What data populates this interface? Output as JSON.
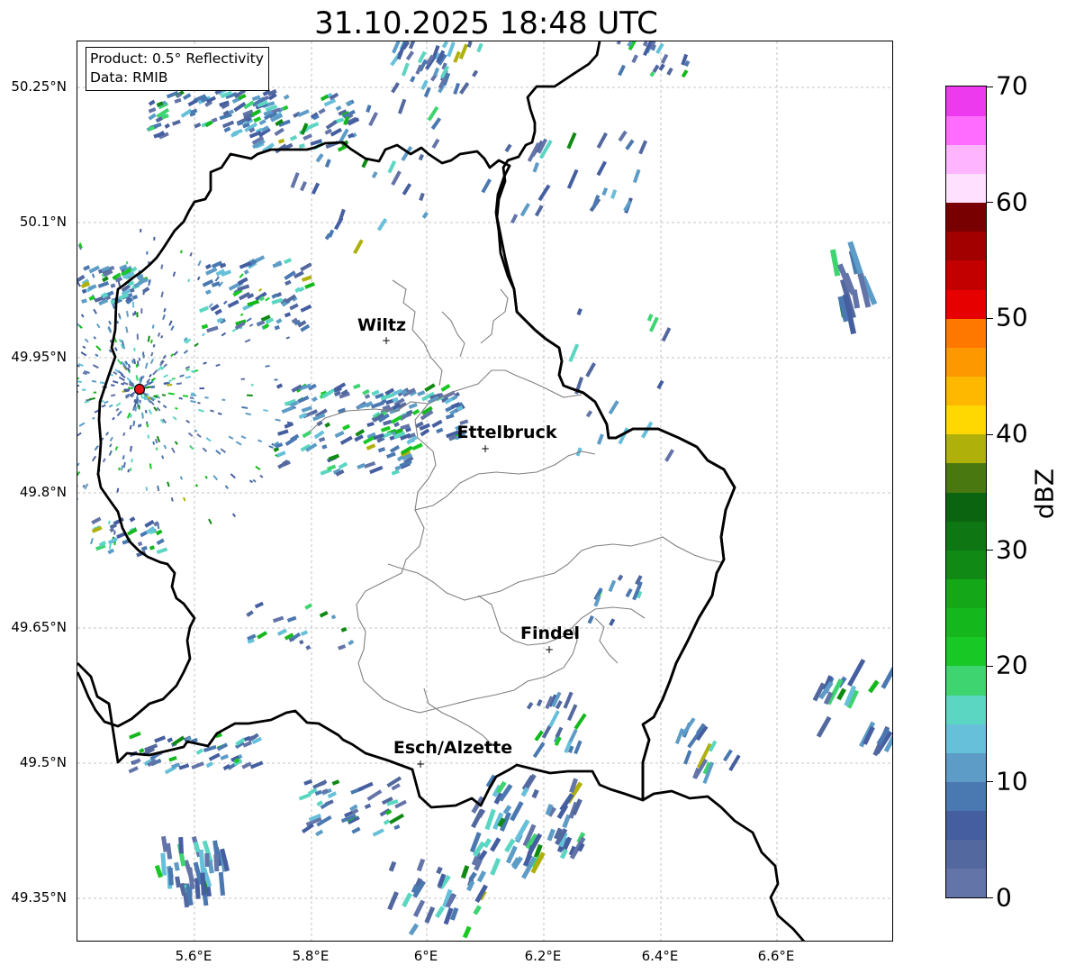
{
  "title": "31.10.2025 18:48 UTC",
  "info_box": {
    "product": "Product: 0.5° Reflectivity",
    "data": "Data: RMIB"
  },
  "map": {
    "latitude_labels": [
      "50.25°N",
      "50.1°N",
      "49.95°N",
      "49.8°N",
      "49.65°N",
      "49.5°N",
      "49.35°N"
    ],
    "longitude_labels": [
      "5.6°E",
      "5.8°E",
      "6°E",
      "6.2°E",
      "6.4°E",
      "6.6°E"
    ],
    "cities": [
      {
        "name": "Wiltz"
      },
      {
        "name": "Ettelbruck"
      },
      {
        "name": "Findel"
      },
      {
        "name": "Esch/Alzette"
      }
    ],
    "radar_marker_color": "#e8141c",
    "border_color": "#000000",
    "canton_color": "#808080"
  },
  "colorbar": {
    "label": "dBZ",
    "tick_labels": [
      "0",
      "10",
      "20",
      "30",
      "40",
      "50",
      "60",
      "70"
    ],
    "colors": [
      "#6374a8",
      "#52689e",
      "#455ea0",
      "#4a78b0",
      "#5c9cc6",
      "#66c0da",
      "#5ad6c2",
      "#3ed470",
      "#18c824",
      "#14b81c",
      "#14a818",
      "#108a14",
      "#0e7612",
      "#0b6410",
      "#4a7810",
      "#b0b00a",
      "#fed800",
      "#feb800",
      "#fe9800",
      "#fe7800",
      "#e60000",
      "#c20000",
      "#a20000",
      "#780000",
      "#ffe0ff",
      "#ffb4ff",
      "#ff6cff",
      "#ee3aee"
    ]
  }
}
